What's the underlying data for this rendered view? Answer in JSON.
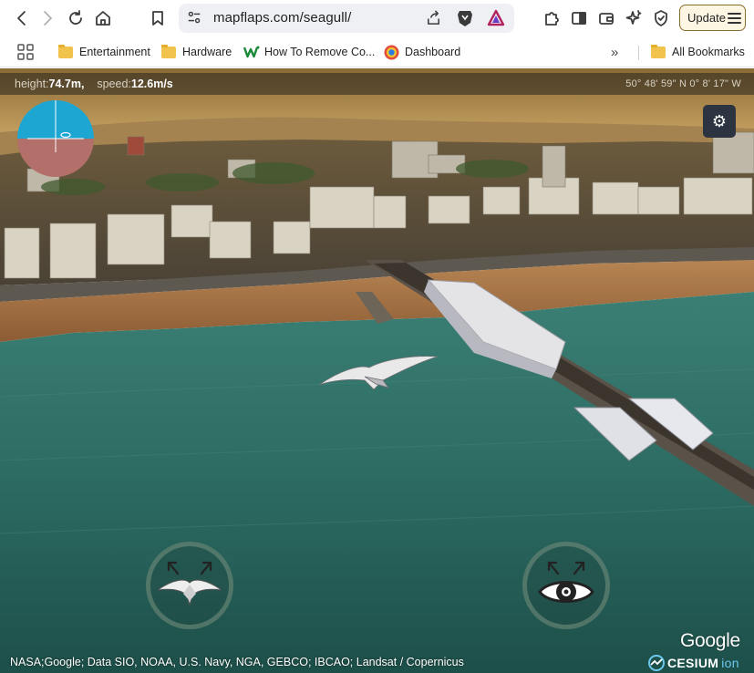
{
  "browser": {
    "url": "mapflaps.com/seagull/",
    "update_label": "Update",
    "bookmarks": [
      {
        "label": "Entertainment",
        "icon": "folder-icon"
      },
      {
        "label": "Hardware",
        "icon": "folder-icon"
      },
      {
        "label": "How To Remove Co...",
        "icon": "w-site-icon"
      },
      {
        "label": "Dashboard",
        "icon": "dashboard-icon"
      }
    ],
    "all_bookmarks": "All Bookmarks",
    "overflow": "»"
  },
  "hud": {
    "height_label": "height:",
    "height_value": "74.7m,",
    "speed_label": "speed:",
    "speed_value": "12.6m/s",
    "coordinates": "50° 48' 59\" N 0° 8' 17\" W"
  },
  "settings_icon": "⚙",
  "attribution": {
    "google": "Google",
    "cesium": "CESIUM",
    "ion": "ion",
    "credits": "NASA;Google; Data SIO, NOAA, U.S. Navy, NGA, GEBCO; IBCAO; Landsat / Copernicus"
  },
  "colors": {
    "sky": "#b58a3c",
    "sea": "#2c6b62",
    "beach": "#a5703f",
    "horizon_sky": "#1aa3cf",
    "horizon_ground": "#b07060"
  }
}
